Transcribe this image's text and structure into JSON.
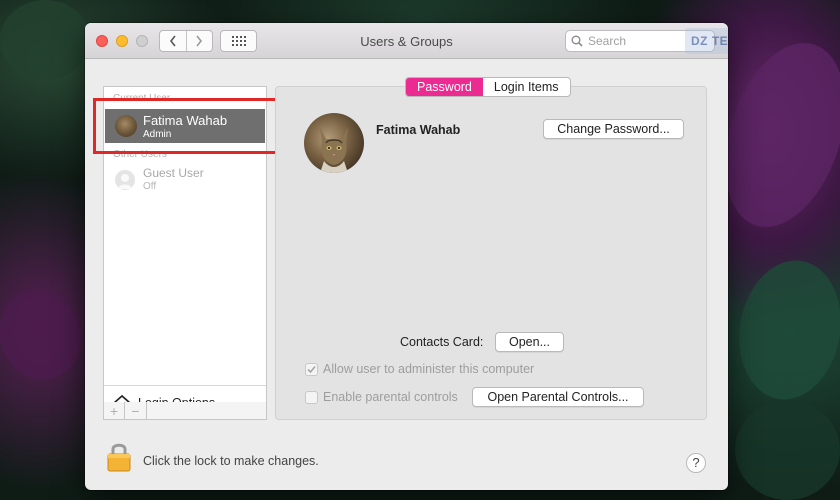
{
  "window": {
    "title": "Users & Groups"
  },
  "search": {
    "placeholder": "Search"
  },
  "watermark": {
    "text": "DZ TECH"
  },
  "sidebar": {
    "current_user_section": "Current User",
    "other_users_section": "Other Users",
    "current_user": {
      "name": "Fatima Wahab",
      "role": "Admin"
    },
    "guest_user": {
      "name": "Guest User",
      "status": "Off"
    },
    "login_options_label": "Login Options",
    "add_symbol": "+",
    "remove_symbol": "−"
  },
  "tabs": [
    {
      "label": "Password",
      "active": true
    },
    {
      "label": "Login Items",
      "active": false
    }
  ],
  "user_panel": {
    "full_name": "Fatima Wahab",
    "change_password_label": "Change Password...",
    "contacts_card_label": "Contacts Card:",
    "open_label": "Open...",
    "allow_admin_label": "Allow user to administer this computer",
    "allow_admin_checked": true,
    "parental_controls_label": "Enable parental controls",
    "parental_controls_checked": false,
    "open_parental_label": "Open Parental Controls..."
  },
  "footer": {
    "lock_text": "Click the lock to make changes.",
    "help_label": "?"
  },
  "colors": {
    "tab_active": "#ec2b92",
    "highlight_border": "#e02828",
    "selected_row": "#6f6f6f",
    "lock_gold": "#f5b335"
  }
}
